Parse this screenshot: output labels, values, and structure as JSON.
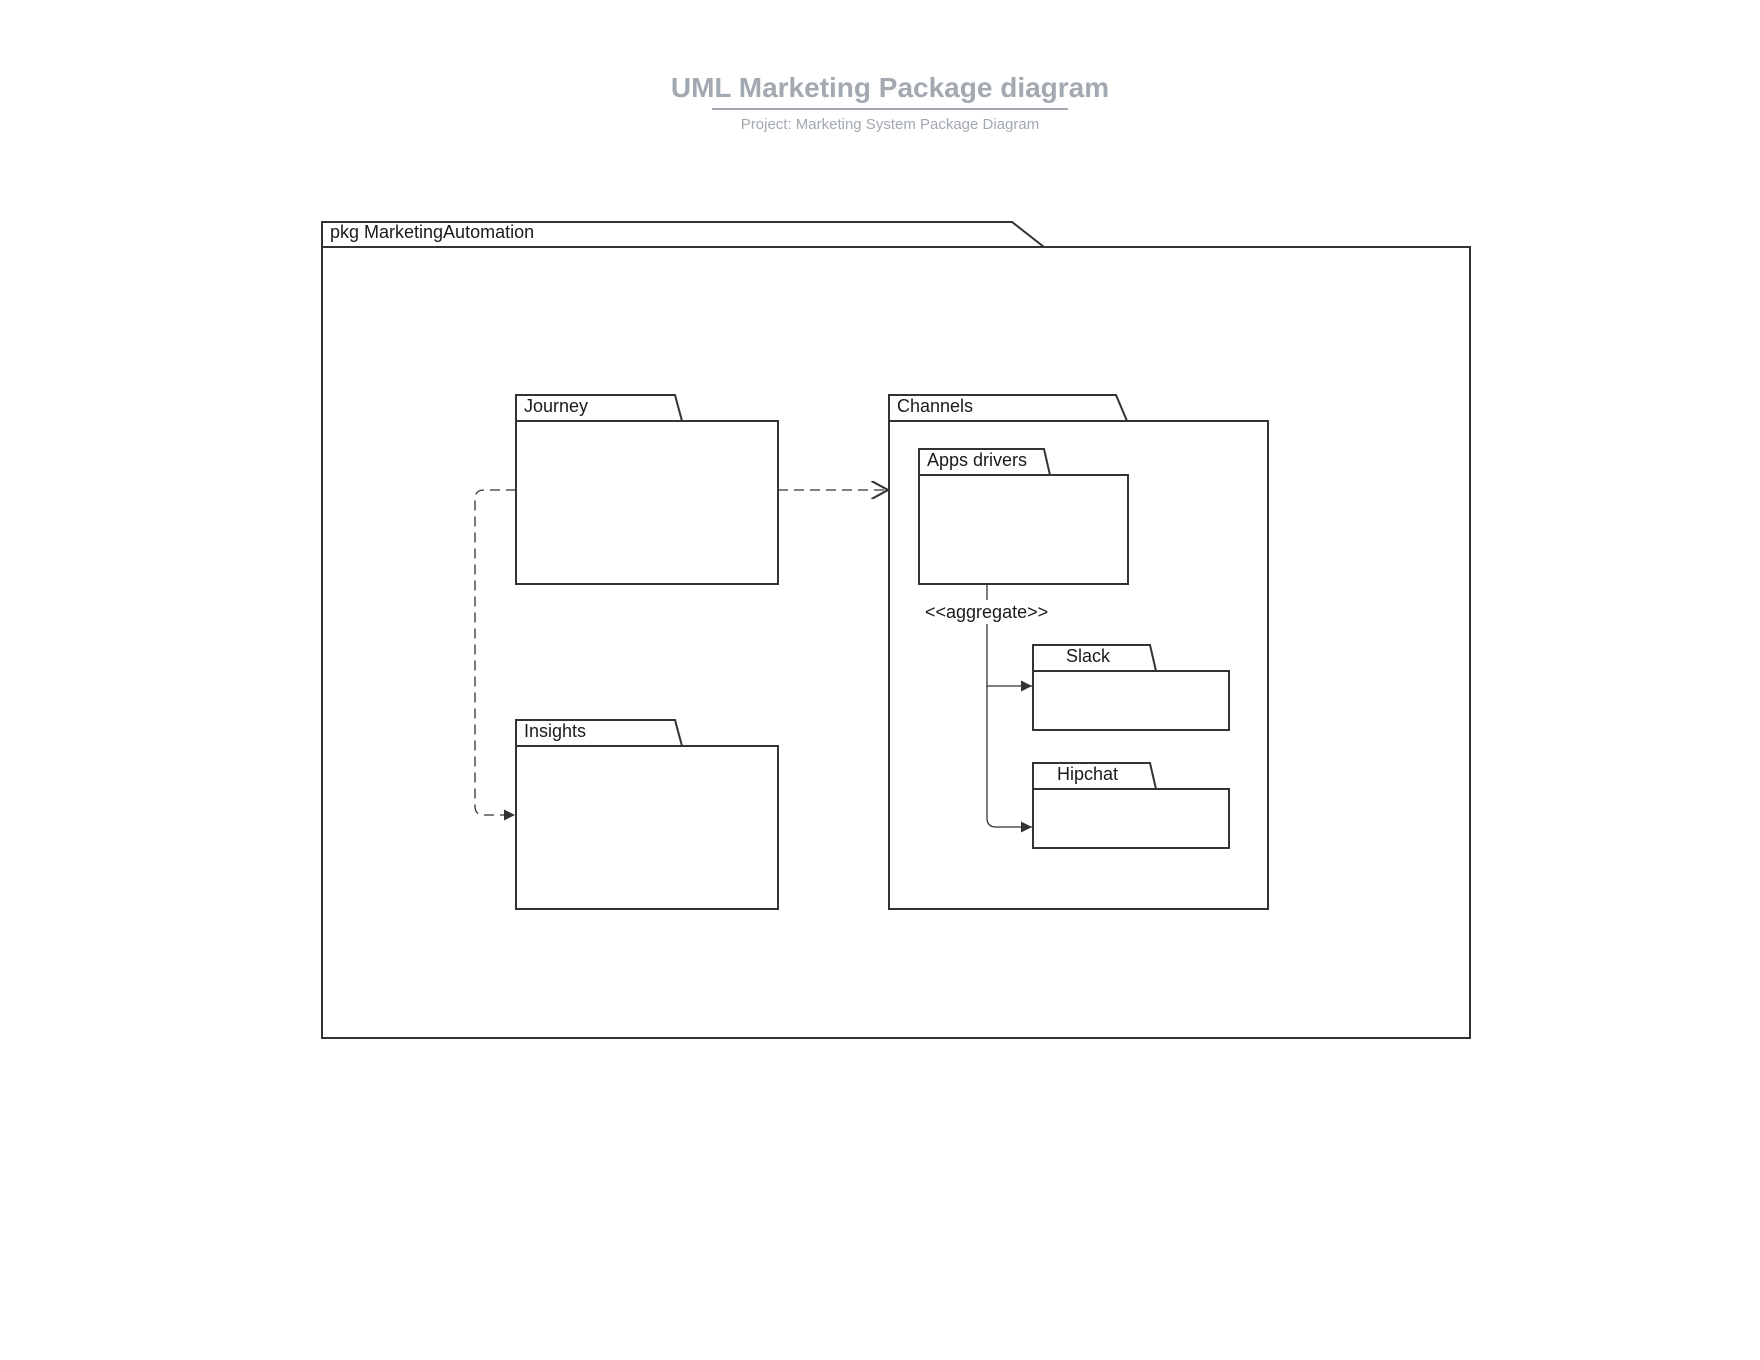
{
  "header": {
    "title": "UML Marketing Package diagram",
    "subtitle": "Project: Marketing System Package Diagram"
  },
  "packages": {
    "outer": "pkg MarketingAutomation",
    "journey": "Journey",
    "insights": "Insights",
    "channels": "Channels",
    "apps_drivers": "Apps drivers",
    "slack": "Slack",
    "hipchat": "Hipchat"
  },
  "relations": {
    "aggregate_label": "<<aggregate>>"
  },
  "colors": {
    "stroke": "#333333",
    "title": "#a3a9b1"
  }
}
